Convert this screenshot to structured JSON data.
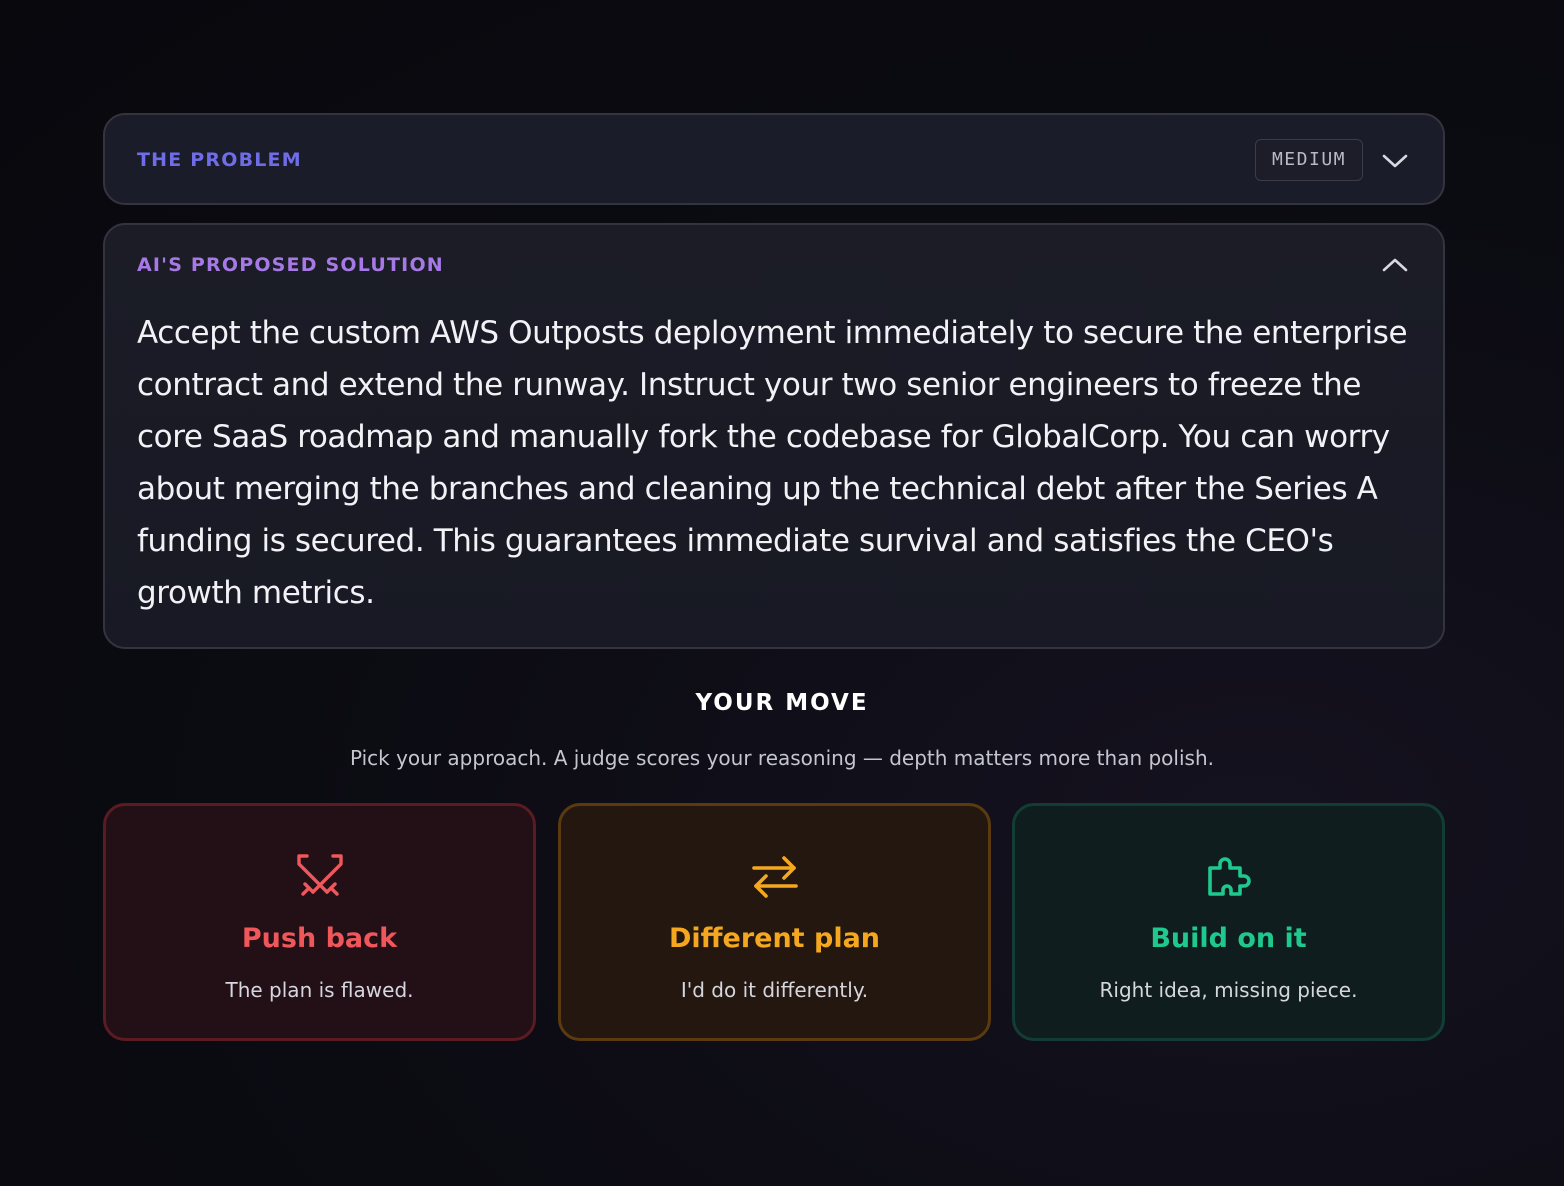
{
  "problem": {
    "label": "THE PROBLEM",
    "difficulty": "MEDIUM",
    "expanded": false
  },
  "solution": {
    "label": "AI'S PROPOSED SOLUTION",
    "text": "Accept the custom AWS Outposts deployment immediately to secure the enterprise contract and extend the runway. Instruct your two senior engineers to freeze the core SaaS roadmap and manually fork the codebase for GlobalCorp. You can worry about merging the branches and cleaning up the technical debt after the Series A funding is secured. This guarantees immediate survival and satisfies the CEO's growth metrics.",
    "expanded": true
  },
  "your_move": {
    "title": "YOUR MOVE",
    "subtitle": "Pick your approach. A judge scores your reasoning — depth matters more than polish."
  },
  "options": [
    {
      "title": "Push back",
      "description": "The plan is flawed.",
      "icon": "crossed-swords-icon",
      "color": "#f0575b"
    },
    {
      "title": "Different plan",
      "description": "I'd do it differently.",
      "icon": "arrows-swap-icon",
      "color": "#f5a81f"
    },
    {
      "title": "Build on it",
      "description": "Right idea, missing piece.",
      "icon": "puzzle-piece-icon",
      "color": "#1fc98d"
    }
  ],
  "colors": {
    "problem_label": "#6f6ce8",
    "solution_label": "#a679e6",
    "background": "#0b0b12"
  }
}
